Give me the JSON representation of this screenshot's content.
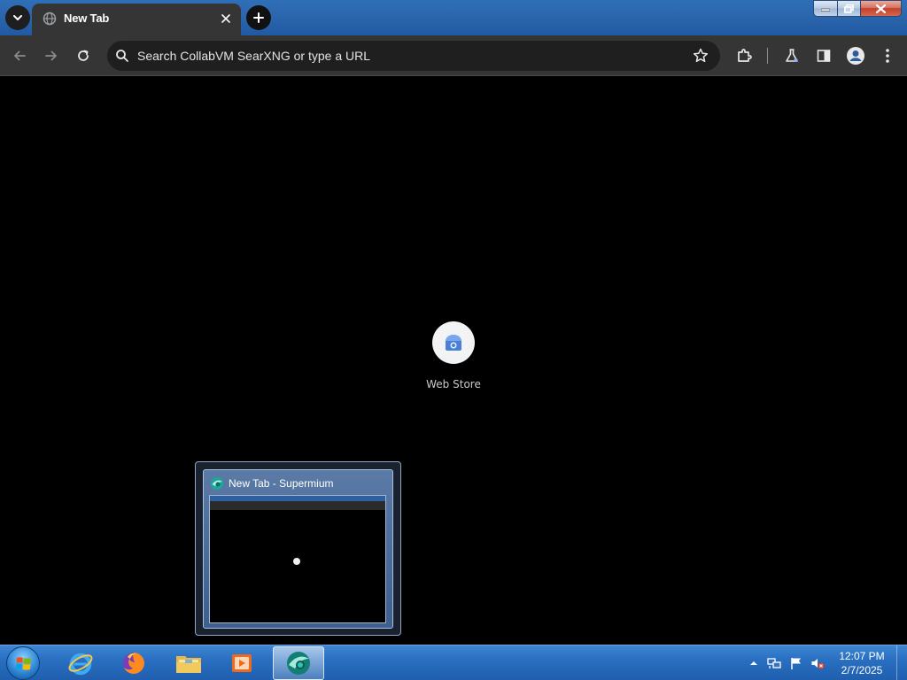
{
  "browser": {
    "tab": {
      "title": "New Tab",
      "icon": "globe-icon"
    },
    "omnibox": {
      "placeholder": "Search CollabVM SearXNG or type a URL",
      "value": ""
    },
    "toolbar_icons": [
      "back-arrow-icon",
      "forward-arrow-icon",
      "reload-icon",
      "star-icon",
      "extensions-puzzle-icon",
      "labs-flask-icon",
      "side-panel-icon",
      "profile-icon",
      "menu-dots-icon"
    ]
  },
  "content": {
    "shortcuts": [
      {
        "label": "Web Store",
        "icon": "web-store-icon"
      }
    ]
  },
  "preview": {
    "title": "New Tab - Supermium"
  },
  "taskbar": {
    "apps": [
      "internet-explorer-icon",
      "firefox-icon",
      "file-explorer-icon",
      "media-player-icon",
      "supermium-icon"
    ],
    "clock": {
      "time": "12:07 PM",
      "date": "2/7/2025"
    },
    "tray_icons": [
      "tray-expand-icon",
      "network-icon",
      "action-center-flag-icon",
      "volume-muted-icon"
    ]
  },
  "colors": {
    "titlebar": "#2b66ad",
    "toolbar": "#353535",
    "omnibox": "#1f1f1f",
    "content_bg": "#000000",
    "taskbar": "#2a6fc1"
  }
}
